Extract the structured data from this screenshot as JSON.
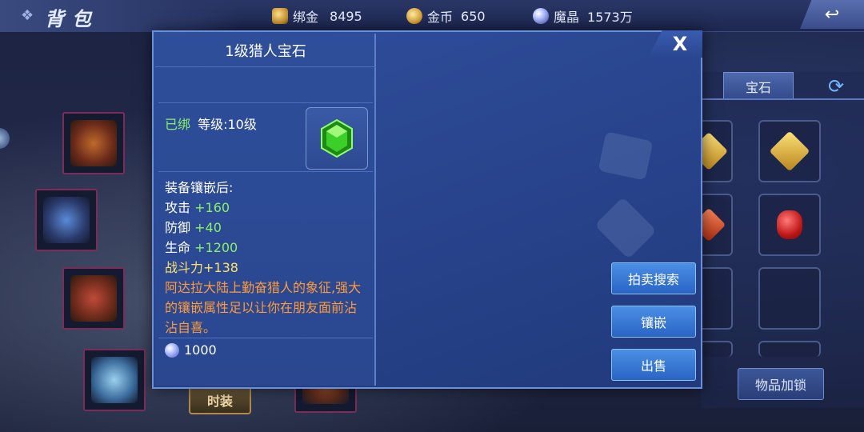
{
  "header": {
    "title": "背包",
    "currencies": [
      {
        "icon": "bound-gold-icon",
        "label": "绑金",
        "value": "8495"
      },
      {
        "icon": "gold-coin-icon",
        "label": "金币",
        "value": "650"
      },
      {
        "icon": "magic-crystal-icon",
        "label": "魔晶",
        "value": "1573万"
      }
    ]
  },
  "left": {
    "costume_label": "时装"
  },
  "right_panel": {
    "tab_active": "宝石",
    "lock_button": "物品加锁"
  },
  "item_detail": {
    "name": "1级猎人宝石",
    "bound": "已绑",
    "level": "等级:10级",
    "inlay_heading": "装备镶嵌后:",
    "stats": [
      {
        "label": "攻击",
        "value": "+160"
      },
      {
        "label": "防御",
        "value": "+40"
      },
      {
        "label": "生命",
        "value": "+1200"
      }
    ],
    "power": "战斗力+138",
    "description": "阿达拉大陆上勤奋猎人的象征,强大的镶嵌属性足以让你在朋友面前沾沾自喜。",
    "price": "1000",
    "gem_color": "#3ccf2a"
  },
  "actions": {
    "auction_search": "拍卖搜索",
    "inlay": "镶嵌",
    "sell": "出售",
    "close": "X"
  }
}
